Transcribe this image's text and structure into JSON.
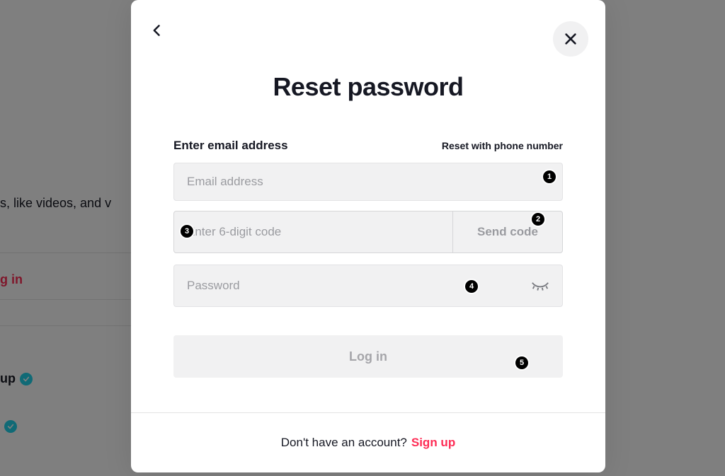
{
  "bg": {
    "top_text": "s, like videos, and v",
    "login_text": "g in",
    "item_text": "up"
  },
  "modal": {
    "title": "Reset password",
    "label_left": "Enter email address",
    "label_right": "Reset with phone number",
    "email": {
      "value": "",
      "placeholder": "Email address"
    },
    "code": {
      "value": "",
      "placeholder": "Enter 6-digit code"
    },
    "send_code_label": "Send code",
    "password": {
      "value": "",
      "placeholder": "Password"
    },
    "login_label": "Log in",
    "footer_text": "Don't have an account?",
    "signup_label": "Sign up"
  },
  "badges": [
    "1",
    "2",
    "3",
    "4",
    "5"
  ]
}
